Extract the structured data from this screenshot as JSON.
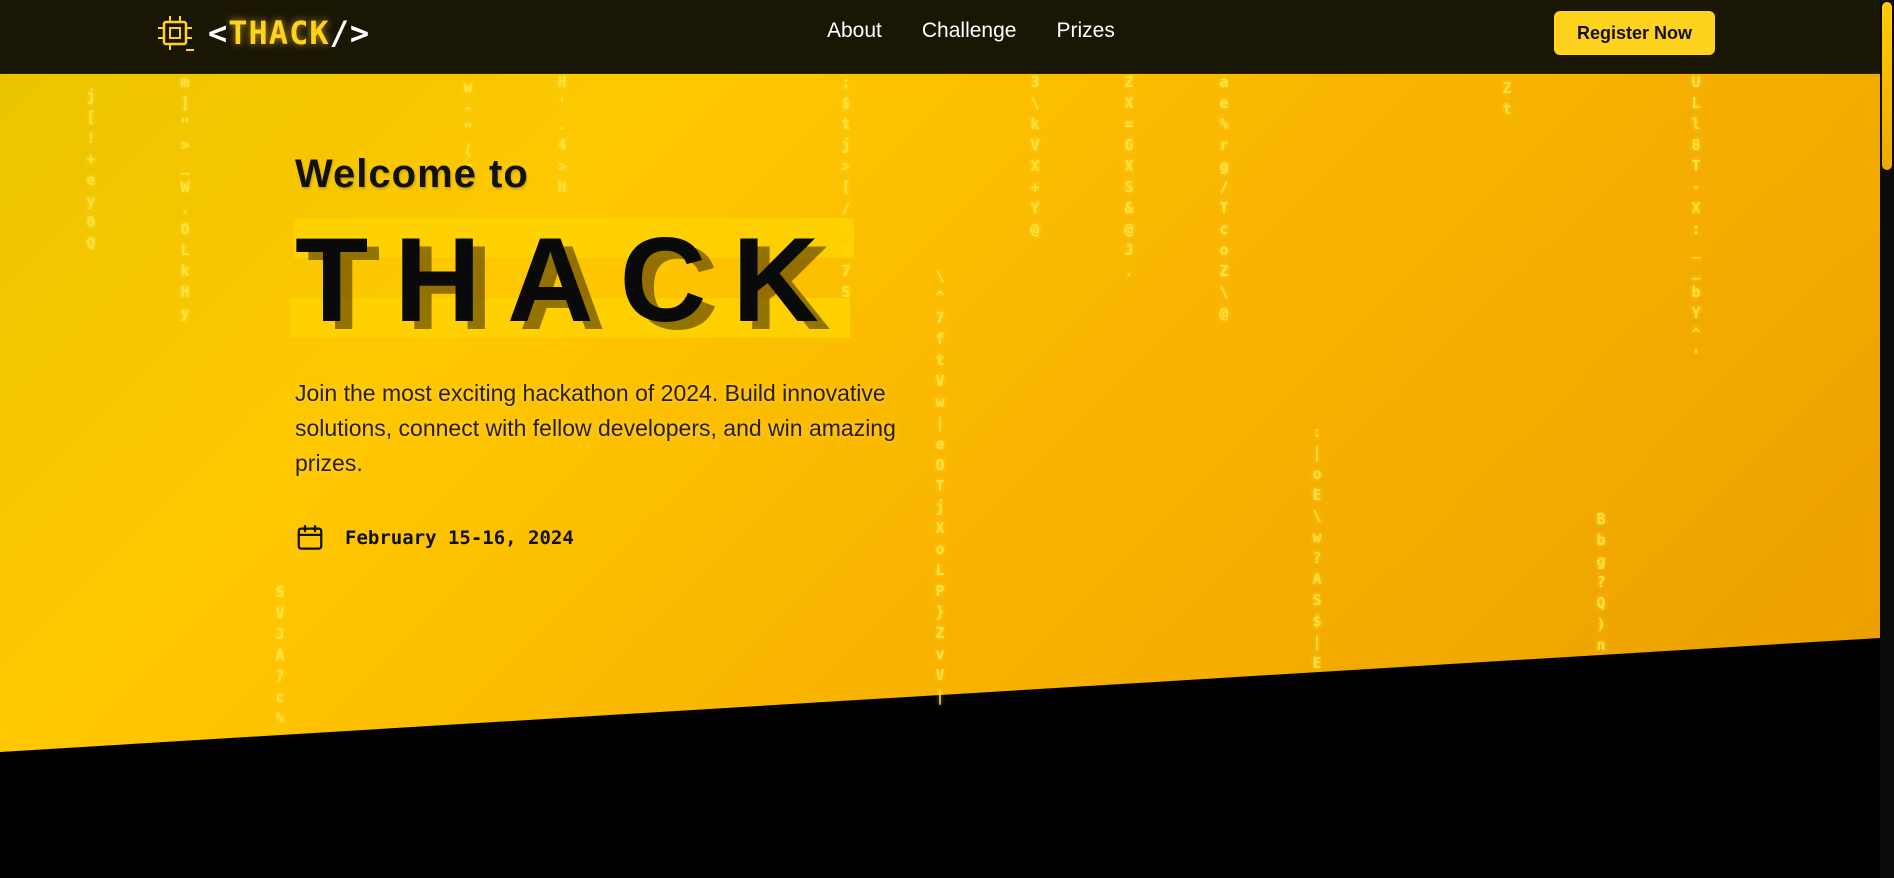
{
  "nav": {
    "logo_prefix": "<",
    "logo_brand": "THACK",
    "logo_suffix": "/>",
    "links": [
      "About",
      "Challenge",
      "Prizes"
    ],
    "register_label": "Register Now"
  },
  "hero": {
    "welcome": "Welcome to",
    "title": "THACK",
    "description": "Join the most exciting hackathon of 2024. Build innovative solutions, connect with fellow developers, and win amazing prizes.",
    "date": "February 15-16, 2024"
  },
  "rain_columns": [
    "j\n[\n!\n+\ne\ny\n0\nQ",
    "m\n]\n\"\n>\n_\nW\n.\nO\nL\nk\nH\ny",
    "w\n-\n\"\n(\nf",
    "H\n'\n.\n4\n>\nH",
    ";\n$\nt\nj\n>\n[\n/\nG\n0\n7\nS\n3",
    "\\\n^\n7\nf\nt\nV\nw\n|\ne\nO\nT\nj\nX\no\nL\nP\n}\nZ\nv\nV\n|",
    "3\n\\\nk\nV\nX\n+\nY\n@",
    "Z\nX\n=\nG\nX\nS\n&\n@\nJ\n.",
    "a\ne\n%\nr\ng\n/\nT\nc\no\nZ\n\\\n@",
    "Z\nt",
    ":\n|\no\nE\n\\\nw\n?\nA\nS\n$\n|\nE",
    "B\nb\ng\n?\nQ\n)\nn",
    "U\nL\nl\n8\nT\n-\nX\n:\n_\n_\nb\nY\n^\n'",
    "S\nV\nJ\nA\n?\nc\n%"
  ],
  "colors": {
    "accent": "#ffd21e",
    "nav_bg": "#1a1604",
    "hero_start": "#e9c400",
    "hero_end": "#e99c00"
  }
}
